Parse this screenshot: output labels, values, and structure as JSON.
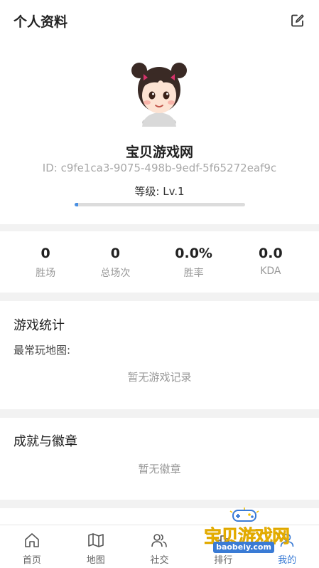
{
  "header": {
    "title": "个人资料",
    "edit_icon": "edit-icon"
  },
  "profile": {
    "nickname": "宝贝游戏网",
    "user_id": "ID: c9fe1ca3-9075-498b-9edf-5f65272eaf9c",
    "level": "等级: Lv.1",
    "xp_progress": 0.02,
    "avatar_icon": "girl-avatar"
  },
  "stats": [
    {
      "value": "0",
      "label": "胜场"
    },
    {
      "value": "0",
      "label": "总场次"
    },
    {
      "value": "0.0%",
      "label": "胜率"
    },
    {
      "value": "0.0",
      "label": "KDA"
    }
  ],
  "game_stats": {
    "title": "游戏统计",
    "favorite_map_label": "最常玩地图:",
    "empty_text": "暂无游戏记录"
  },
  "achievements": {
    "title": "成就与徽章",
    "empty_text": "暂无徽章"
  },
  "next_section": {
    "title": ""
  },
  "tabbar": {
    "items": [
      {
        "label": "首页",
        "icon": "home-icon"
      },
      {
        "label": "地图",
        "icon": "map-icon"
      },
      {
        "label": "社交",
        "icon": "friends-icon"
      },
      {
        "label": "排行",
        "icon": "ranking-icon"
      },
      {
        "label": "我的",
        "icon": "user-icon"
      }
    ],
    "active_index": 4
  },
  "watermark": {
    "text": "宝贝游戏网",
    "url": "baobeiy.com"
  },
  "colors": {
    "accent": "#3a7bd5",
    "watermark": "#f5c300",
    "background": "#f2f2f2"
  }
}
